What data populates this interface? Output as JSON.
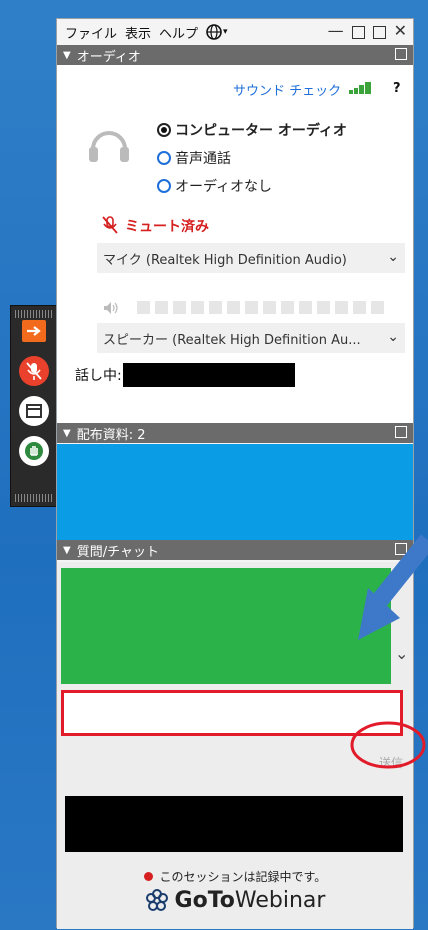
{
  "menu": {
    "file": "ファイル",
    "view": "表示",
    "help": "ヘルプ"
  },
  "audio": {
    "header": "オーディオ",
    "sound_check": "サウンド チェック",
    "help": "?",
    "options": [
      "コンピューター オーディオ",
      "音声通話",
      "オーディオなし"
    ],
    "muted": "ミュート済み",
    "mic_device": "マイク (Realtek High Definition Audio)",
    "speaker_device": "スピーカー (Realtek High Definition Au...",
    "talking_label": "話し中:"
  },
  "handouts": {
    "header": "配布資料: 2"
  },
  "qa": {
    "header": "質問/チャット",
    "send_label": "送信",
    "recording_notice": "このセッションは記録中です。"
  },
  "brand": {
    "goto": "GoTo",
    "webinar": "Webinar"
  },
  "colors": {
    "accent_blue": "#1e6fd9",
    "muted_red": "#d61f1f",
    "handout_blue": "#0a9de6",
    "chat_green": "#2bb34a",
    "annotation_red": "#e21b2a",
    "annotation_arrow": "#3e78c8"
  }
}
